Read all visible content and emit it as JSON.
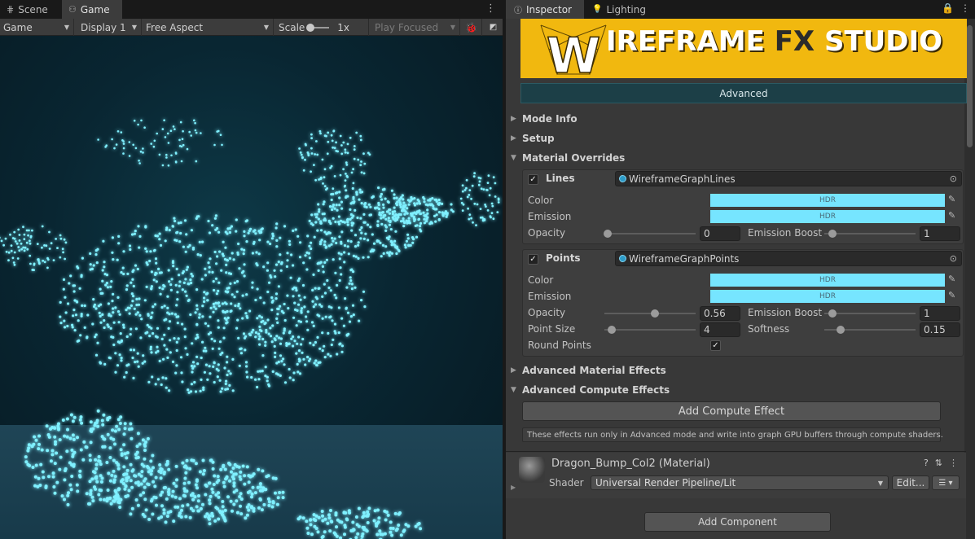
{
  "game_panel": {
    "tabs": [
      {
        "label": "Scene",
        "icon": "grid-icon"
      },
      {
        "label": "Game",
        "icon": "gamepad-icon"
      }
    ],
    "toolbar": {
      "mode": "Game",
      "display": "Display 1",
      "aspect": "Free Aspect",
      "scale_label": "Scale",
      "scale_value": "1x",
      "play_focus": "Play Focused"
    }
  },
  "inspector": {
    "tabs": [
      {
        "label": "Inspector",
        "icon": "info-icon"
      },
      {
        "label": "Lighting",
        "icon": "bulb-icon"
      }
    ],
    "banner": {
      "title_a": "IREFRAME ",
      "title_fx": "FX",
      "title_b": " STUDIO",
      "logo_letter": "W"
    },
    "mode_button": "Advanced",
    "sections": {
      "mode_info": "Mode Info",
      "setup": "Setup",
      "material_overrides": "Material Overrides",
      "advanced_material_effects": "Advanced Material Effects",
      "advanced_compute_effects": "Advanced Compute Effects"
    },
    "lines": {
      "title": "Lines",
      "material": "WireframeGraphLines",
      "color_label": "Color",
      "color_hdr": "HDR",
      "emission_label": "Emission",
      "emission_hdr": "HDR",
      "opacity_label": "Opacity",
      "opacity_value": "0",
      "opacity_fraction": 0.0,
      "emission_boost_label": "Emission Boost",
      "emission_boost_value": "1"
    },
    "points": {
      "title": "Points",
      "material": "WireframeGraphPoints",
      "color_label": "Color",
      "color_hdr": "HDR",
      "emission_label": "Emission",
      "emission_hdr": "HDR",
      "opacity_label": "Opacity",
      "opacity_value": "0.56",
      "emission_boost_label": "Emission Boost",
      "emission_boost_value": "1",
      "point_size_label": "Point Size",
      "point_size_value": "4",
      "softness_label": "Softness",
      "softness_value": "0.15",
      "round_points_label": "Round Points"
    },
    "add_compute_effect": "Add Compute Effect",
    "compute_info": "These effects run only in Advanced mode and write into graph GPU buffers through compute shaders.",
    "material_component": {
      "name": "Dragon_Bump_Col2 (Material)",
      "shader_label": "Shader",
      "shader_value": "Universal Render Pipeline/Lit",
      "edit_button": "Edit..."
    },
    "add_component": "Add Component"
  },
  "colors": {
    "hdr_swatch": "#76e5ff",
    "banner_bg": "#f1b80f",
    "advanced_bar": "#1c3f47",
    "points_glow": "#7ff0ff"
  }
}
